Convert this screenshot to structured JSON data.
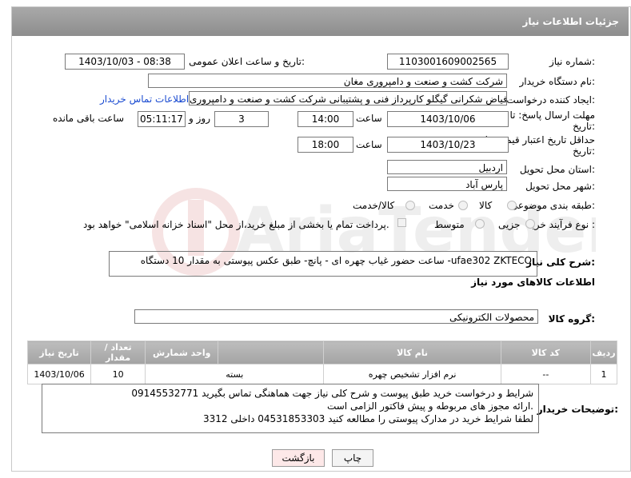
{
  "header": {
    "title": "جزئیات اطلاعات نیاز"
  },
  "need_number": {
    "label": "شماره نیاز:",
    "value": "1103001609002565"
  },
  "announce_datetime": {
    "label": "تاریخ و ساعت اعلان عمومی:",
    "value": "1403/10/03 - 08:38"
  },
  "buyer_org": {
    "label": "نام دستگاه خریدار:",
    "value": "شرکت کشت و صنعت و دامپروری مغان"
  },
  "requester": {
    "label": "ایجاد کننده درخواست:",
    "value": "فیاض شکرانی گیگلو کارپرداز فنی و پشتیبانی شرکت کشت و صنعت و دامپروری",
    "contact_link": "اطلاعات تماس خریدار"
  },
  "deadline": {
    "label_line1": "مهلت ارسال پاسخ: تا",
    "label_line2": "تاریخ:",
    "date": "1403/10/06",
    "time_label": "ساعت",
    "time": "14:00",
    "days": "3",
    "days_label": "روز و",
    "remaining": "05:11:17",
    "remaining_label": "ساعت باقی مانده"
  },
  "price_validity": {
    "label_line1": "حداقل تاریخ اعتبار قیمت: تا",
    "label_line2": "تاریخ:",
    "date": "1403/10/23",
    "time_label": "ساعت",
    "time": "18:00"
  },
  "province": {
    "label": "استان محل تحویل:",
    "value": "اردبیل"
  },
  "city": {
    "label": "شهر محل تحویل:",
    "value": "پارس آباد"
  },
  "category": {
    "label": "طبقه بندی موضوعی:",
    "options": [
      "کالا",
      "خدمت",
      "کالا/خدمت"
    ]
  },
  "purchase_type": {
    "label": "نوع فرآیند خرید :",
    "options": [
      "جزیی",
      "متوسط"
    ],
    "payment_note": "پرداخت تمام یا بخشی از مبلغ خرید،از محل \"اسناد خزانه اسلامی\" خواهد بود."
  },
  "description": {
    "label": "شرح کلی نیاز:",
    "value": "ساعت حضور غیاب چهره ای - پانچ- طبق عکس پیوستی به مقدار 10 دستگاه -ufae302 ZKTECO"
  },
  "goods_section": {
    "title": "اطلاعات کالاهای مورد نیاز"
  },
  "goods_group": {
    "label": "گروه کالا:",
    "value": "محصولات الکترونیکی"
  },
  "table": {
    "headers": [
      "ردیف",
      "کد کالا",
      "نام کالا",
      "واحد شمارش",
      "تعداد / مقدار",
      "تاریخ نیاز"
    ],
    "rows": [
      [
        "1",
        "--",
        "نرم افزار تشخیص چهره",
        "بسته",
        "10",
        "1403/10/06"
      ]
    ]
  },
  "buyer_notes": {
    "label": "توضیحات خریدار:",
    "line1": "شرایط و درخواست خرید طبق پیوست و شرح کلی نیاز  جهت هماهنگی تماس بگیرید 09145532771",
    "line2": "ارائه مجوز های مربوطه و پیش فاکتور الزامی است.",
    "line3": "لطفا شرایط خرید در مدارک پیوستی را مطالعه کنید  04531853303   داخلی  3312"
  },
  "buttons": {
    "print": "چاپ",
    "back": "بازگشت"
  },
  "colors": {
    "header_bg": "#999999",
    "link": "#1a4bd1",
    "back_btn_bg": "#fde8e8"
  }
}
